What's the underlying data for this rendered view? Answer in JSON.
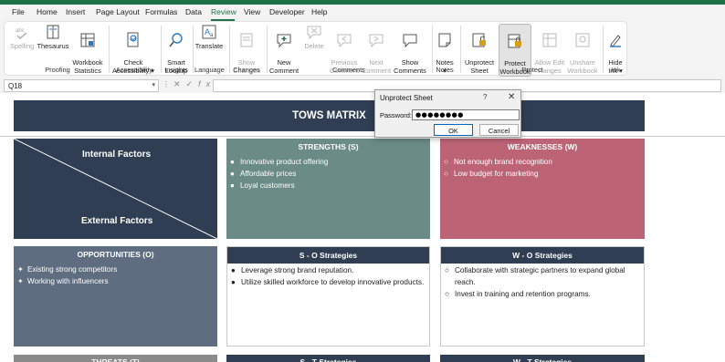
{
  "menu": [
    "File",
    "Home",
    "Insert",
    "Page Layout",
    "Formulas",
    "Data",
    "Review",
    "View",
    "Developer",
    "Help"
  ],
  "active_tab": "Review",
  "ribbon": {
    "proofing": {
      "group": "Proofing",
      "buttons": [
        "Spelling",
        "Thesaurus",
        "Workbook\nStatistics"
      ]
    },
    "accessibility": {
      "group": "Accessibility",
      "buttons": [
        "Check\nAccessibility ▾"
      ]
    },
    "insights": {
      "group": "Insights",
      "buttons": [
        "Smart\nLookup"
      ]
    },
    "language": {
      "group": "Language",
      "buttons": [
        "Translate"
      ]
    },
    "changes": {
      "group": "Changes",
      "buttons": [
        "Show\nChanges"
      ]
    },
    "comments": {
      "group": "Comments",
      "buttons": [
        "New\nComment",
        "Delete",
        "Previous\nComment",
        "Next\nComment",
        "Show\nComments"
      ]
    },
    "notes": {
      "group": "Notes",
      "buttons": [
        "Notes\n▾"
      ]
    },
    "protect": {
      "group": "Protect",
      "buttons": [
        "Unprotect\nSheet",
        "Protect\nWorkbook",
        "Allow Edit\nRanges",
        "Unshare\nWorkbook"
      ]
    },
    "ink": {
      "group": "Ink",
      "buttons": [
        "Hide\nInk ▾"
      ]
    }
  },
  "formula_bar": {
    "name_box": "Q18",
    "fx": "fx",
    "value": ""
  },
  "sheet": {
    "title": "TOWS MATRIX",
    "internal_factors": "Internal Factors",
    "external_factors": "External Factors",
    "strengths": {
      "title": "STRENGTHS (S)",
      "items": [
        "Innovative product offering",
        "Affordable prices",
        "Loyal customers"
      ]
    },
    "weaknesses": {
      "title": "WEAKNESSES (W)",
      "items": [
        "Not enough brand recognition",
        "Low budget for marketing"
      ]
    },
    "opportunities": {
      "title": "OPPORTUNITIES (O)",
      "items": [
        "Existing strong competitors",
        "Working with influencers"
      ]
    },
    "so": {
      "title": "S - O Strategies",
      "items": [
        "Leverage strong brand reputation.",
        "Utilize skilled workforce to develop innovative products."
      ]
    },
    "wo": {
      "title": "W - O Strategies",
      "items": [
        "Collaborate with strategic partners to expand global reach.",
        "Invest in training and retention programs."
      ]
    },
    "bottom_row_titles": [
      "THREATS (T)",
      "S - T Strategies",
      "W - T Strategies"
    ]
  },
  "dialog": {
    "title": "Unprotect Sheet",
    "help": "?",
    "close": "✕",
    "password_label": "Password:",
    "password_value": "●●●●●●●●",
    "ok": "OK",
    "cancel": "Cancel"
  },
  "colors": {
    "accent": "#1e7145",
    "header": "#2f3e52",
    "strengths": "#6a8b86",
    "weaknesses": "#bc6476",
    "opportunities": "#5e6d80"
  }
}
